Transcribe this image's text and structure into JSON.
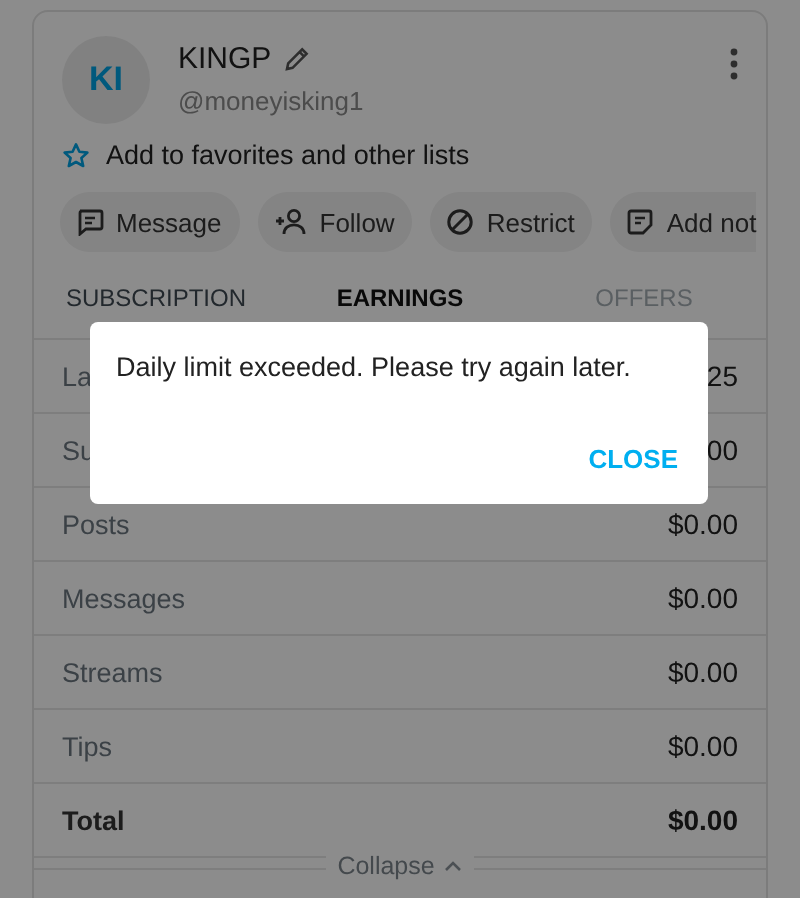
{
  "profile": {
    "avatar_initials": "KI",
    "name": "KINGP",
    "handle": "@moneyisking1",
    "favorites_link": "Add to favorites and other lists"
  },
  "actions": [
    {
      "kind": "message",
      "label": "Message"
    },
    {
      "kind": "follow",
      "label": "Follow"
    },
    {
      "kind": "restrict",
      "label": "Restrict"
    },
    {
      "kind": "note",
      "label": "Add not"
    }
  ],
  "tabs": [
    {
      "label": "SUBSCRIPTION",
      "selected": false,
      "disabled": false
    },
    {
      "label": "EARNINGS",
      "selected": true,
      "disabled": false
    },
    {
      "label": "OFFERS",
      "selected": false,
      "disabled": true
    }
  ],
  "rows": [
    {
      "kind": "item",
      "label": "La",
      "value": "25"
    },
    {
      "kind": "item",
      "label": "Su",
      "value": "00"
    },
    {
      "kind": "item",
      "label": "Posts",
      "value": "$0.00"
    },
    {
      "kind": "item",
      "label": "Messages",
      "value": "$0.00"
    },
    {
      "kind": "item",
      "label": "Streams",
      "value": "$0.00"
    },
    {
      "kind": "item",
      "label": "Tips",
      "value": "$0.00"
    },
    {
      "kind": "total",
      "label": "Total",
      "value": "$0.00"
    }
  ],
  "collapse_label": "Collapse",
  "dialog": {
    "message": "Daily limit exceeded. Please try again later.",
    "button": "CLOSE"
  }
}
